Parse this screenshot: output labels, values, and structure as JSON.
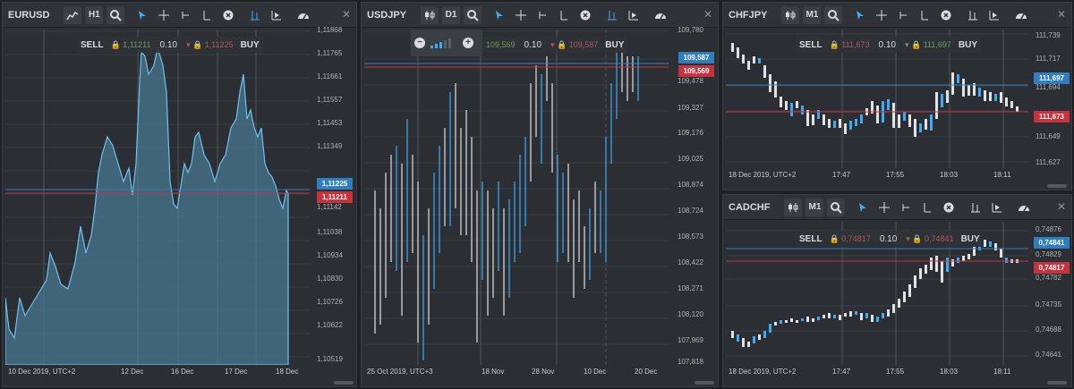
{
  "panels": {
    "eurusd": {
      "symbol": "EURUSD",
      "timeframe": "H1",
      "sell_label": "SELL",
      "buy_label": "BUY",
      "bid": "1,11211",
      "qty": "0.10",
      "ask": "1,11225",
      "axis": [
        "1,11868",
        "1,11765",
        "1,11661",
        "1,11557",
        "1,11453",
        "1,11349",
        "1,11142",
        "1,11038",
        "1,10934",
        "1,10830",
        "1,10726",
        "1,10622",
        "1,10519"
      ],
      "price_ask_tag": "1,11225",
      "price_bid_tag": "1,11211",
      "x_labels": [
        "10 Dec 2019, UTC+2",
        "12 Dec",
        "16 Dec",
        "17 Dec",
        "18 Dec"
      ]
    },
    "usdjpy": {
      "symbol": "USDJPY",
      "timeframe": "D1",
      "sell_label": "SELL",
      "buy_label": "BUY",
      "bid": "109,569",
      "qty": "0.10",
      "ask": "109,587",
      "axis": [
        "109,780",
        "109,478",
        "109,327",
        "109,176",
        "109,025",
        "108,874",
        "108,724",
        "108,573",
        "108,422",
        "108,271",
        "108,120",
        "107,969",
        "107,818"
      ],
      "price_ask_tag": "109,587",
      "price_bid_tag": "109,569",
      "x_labels": [
        "25 Oct 2019, UTC+3",
        "18 Nov",
        "28 Nov",
        "10 Dec",
        "20 Dec"
      ]
    },
    "chfjpy": {
      "symbol": "CHFJPY",
      "timeframe": "M1",
      "sell_label": "SELL",
      "buy_label": "BUY",
      "bid": "111,673",
      "qty": "0.10",
      "ask": "111,697",
      "axis": [
        "111,739",
        "111,717",
        "111,694",
        "111,649",
        "111,627"
      ],
      "price_ask_tag": "111,697",
      "price_bid_tag": "111,673",
      "x_labels": [
        "18 Dec 2019, UTC+2",
        "17:47",
        "17:55",
        "18:03",
        "18:11"
      ]
    },
    "cadchf": {
      "symbol": "CADCHF",
      "timeframe": "M1",
      "sell_label": "SELL",
      "buy_label": "BUY",
      "bid": "0,74817",
      "qty": "0.10",
      "ask": "0,74841",
      "axis": [
        "0,74876",
        "0,74829",
        "0,74782",
        "0,74735",
        "0,74688",
        "0,74641"
      ],
      "price_ask_tag": "0,74841",
      "price_bid_tag": "0,74817",
      "x_labels": [
        "18 Dec 2019, UTC+2",
        "17:47",
        "17:55",
        "18:03",
        "18:11"
      ]
    }
  },
  "colors": {
    "accent": "#3ea9f5",
    "ask_tag": "#2f7fc0",
    "bid_tag": "#c8323c",
    "area_fill": "#4a7a96"
  },
  "icons": [
    "area-chart-icon",
    "candles-icon",
    "zoom-icon",
    "pointer-icon",
    "crosshair-icon",
    "trend-icon",
    "line-icon",
    "close-icon",
    "bars-icon",
    "play-icon",
    "gauge-icon"
  ]
}
